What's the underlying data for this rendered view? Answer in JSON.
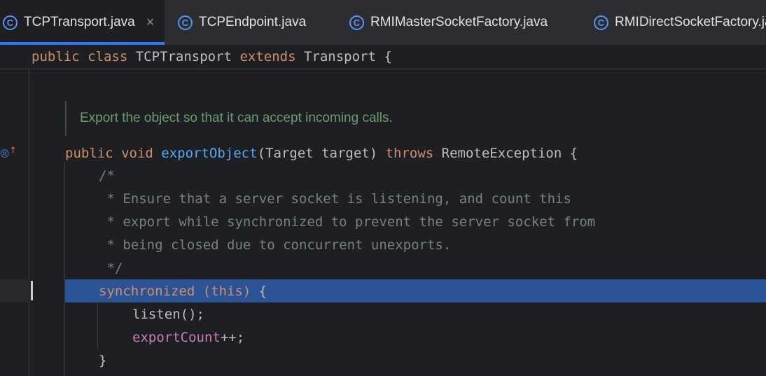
{
  "tabs": [
    {
      "icon": "C",
      "label": "TCPTransport.java",
      "close": "×"
    },
    {
      "icon": "C",
      "label": "TCPEndpoint.java"
    },
    {
      "icon": "C",
      "label": "RMIMasterSocketFactory.java"
    },
    {
      "icon": "C",
      "label": "RMIDirectSocketFactory.java"
    }
  ],
  "sticky": {
    "t1": "public class",
    "t2": " TCPTransport ",
    "t3": "extends",
    "t4": " Transport {"
  },
  "doc": "Export the object so that it can accept incoming calls.",
  "code": {
    "l1": {
      "a": "public void ",
      "b": "exportObject",
      "c": "(Target target) ",
      "d": "throws",
      "e": " RemoteException {"
    },
    "c1": "/*",
    "c2": " * Ensure that a server socket is listening, and count this",
    "c3": " * export while synchronized to prevent the server socket from",
    "c4": " * being closed due to concurrent unexports.",
    "c5": " */",
    "s1": {
      "a": "synchronized ",
      "b": "(this)",
      "c": " {"
    },
    "s2": "listen();",
    "s3": {
      "a": "exportCount",
      "b": "++;"
    },
    "s4": "}"
  },
  "gutter": {
    "icon": "override-up-icon",
    "glyph": "◎",
    "arrow": "↑"
  }
}
